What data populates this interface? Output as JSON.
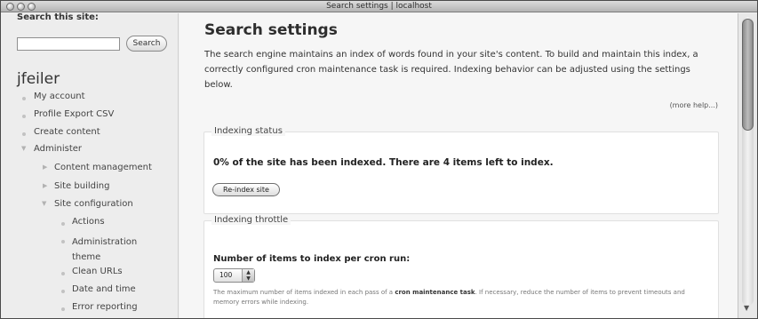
{
  "window": {
    "title": "Search settings | localhost"
  },
  "sidebar": {
    "search_label": "Search this site:",
    "search_placeholder": "",
    "search_button": "Search",
    "username": "jfeiler",
    "items": [
      {
        "label": "My account",
        "level": 0,
        "marker": "bullet"
      },
      {
        "label": "Profile Export CSV",
        "level": 0,
        "marker": "bullet"
      },
      {
        "label": "Create content",
        "level": 0,
        "marker": "bullet"
      },
      {
        "label": "Administer",
        "level": 0,
        "marker": "expanded-arrow"
      },
      {
        "label": "Content management",
        "level": 1,
        "marker": "collapsed-arrow"
      },
      {
        "label": "Site building",
        "level": 1,
        "marker": "collapsed-arrow"
      },
      {
        "label": "Site configuration",
        "level": 1,
        "marker": "expanded-arrow"
      },
      {
        "label": "Actions",
        "level": 2,
        "marker": "bullet"
      },
      {
        "label": "Administration theme",
        "level": 2,
        "marker": "bullet"
      },
      {
        "label": "Clean URLs",
        "level": 2,
        "marker": "bullet"
      },
      {
        "label": "Date and time",
        "level": 2,
        "marker": "bullet"
      },
      {
        "label": "Error reporting",
        "level": 2,
        "marker": "bullet"
      }
    ]
  },
  "main": {
    "title": "Search settings",
    "intro": "The search engine maintains an index of words found in your site's content. To build and maintain this index, a correctly configured cron maintenance task is required. Indexing behavior can be adjusted using the settings below.",
    "more_help": "(more help...)",
    "indexing_status": {
      "legend": "Indexing status",
      "message": "0% of the site has been indexed. There are 4 items left to index.",
      "button": "Re-index site"
    },
    "indexing_throttle": {
      "legend": "Indexing throttle",
      "field_label": "Number of items to index per cron run:",
      "selected_value": "100",
      "description_before": "The maximum number of items indexed in each pass of a ",
      "description_link": "cron maintenance task",
      "description_after": ". If necessary, reduce the number of items to prevent timeouts and memory errors while indexing."
    }
  },
  "icons": {
    "bullet": "bullet-icon",
    "collapsed": "chevron-right-icon",
    "expanded": "chevron-down-icon",
    "select_arrows": "updown-arrows-icon"
  },
  "colors": {
    "window_bg": "#f1f1f1",
    "sidebar_bg": "#ededed",
    "fieldset_bg": "#ffffff",
    "text": "#222222"
  }
}
